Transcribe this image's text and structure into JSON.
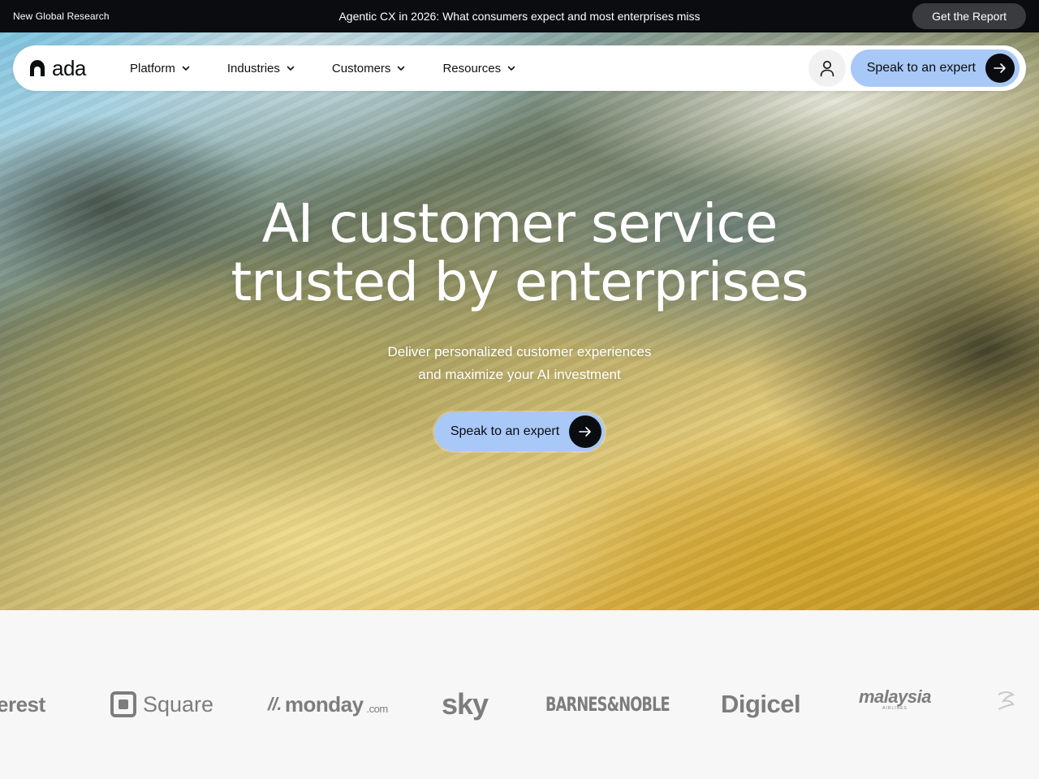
{
  "announcement": {
    "tag": "New Global Research",
    "headline": "Agentic CX in 2026: What consumers expect and most enterprises miss",
    "cta": "Get the Report"
  },
  "nav": {
    "brand": "ada",
    "menu": [
      {
        "label": "Platform"
      },
      {
        "label": "Industries"
      },
      {
        "label": "Customers"
      },
      {
        "label": "Resources"
      }
    ],
    "cta": "Speak to an expert",
    "icons": {
      "account": "user-icon",
      "arrow": "arrow-right-icon",
      "chevron": "chevron-down-icon"
    }
  },
  "hero": {
    "title_line1": "AI customer service",
    "title_line2": "trusted by enterprises",
    "subtitle_line1": "Deliver personalized customer experiences",
    "subtitle_line2": "and maximize your AI investment",
    "cta": "Speak to an expert"
  },
  "logos": {
    "pinterest_partial": "erest",
    "square": "Square",
    "monday": "monday",
    "monday_suffix": ".com",
    "sky": "sky",
    "barnes_noble": "BARNES&NOBLE",
    "digicel": "Digicel",
    "malaysia": "malaysia",
    "malaysia_sub": "AIRLINES"
  },
  "colors": {
    "topbar": "#0b0c0f",
    "accent": "#a8c8f7",
    "logo_gray": "#7d7d7d"
  }
}
